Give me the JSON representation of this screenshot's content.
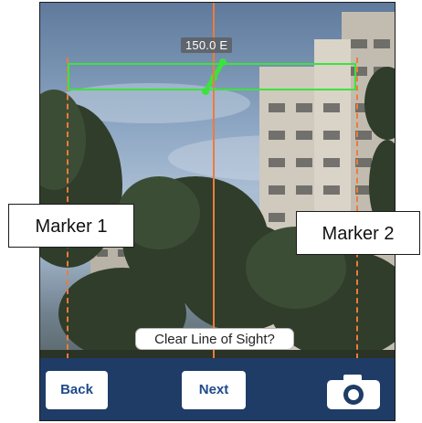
{
  "overlay": {
    "heading_readout": "150.0 E",
    "los_prompt": "Clear Line of Sight?"
  },
  "toolbar": {
    "back_label": "Back",
    "next_label": "Next",
    "camera_icon": "camera-icon"
  },
  "markers": {
    "marker_1_label": "Marker 1",
    "marker_2_label": "Marker 2"
  },
  "colors": {
    "guide_line": "#f07a3a",
    "target_box": "#3ee23e",
    "toolbar_bg": "#1f3c66",
    "button_text": "#1f4a8a"
  }
}
